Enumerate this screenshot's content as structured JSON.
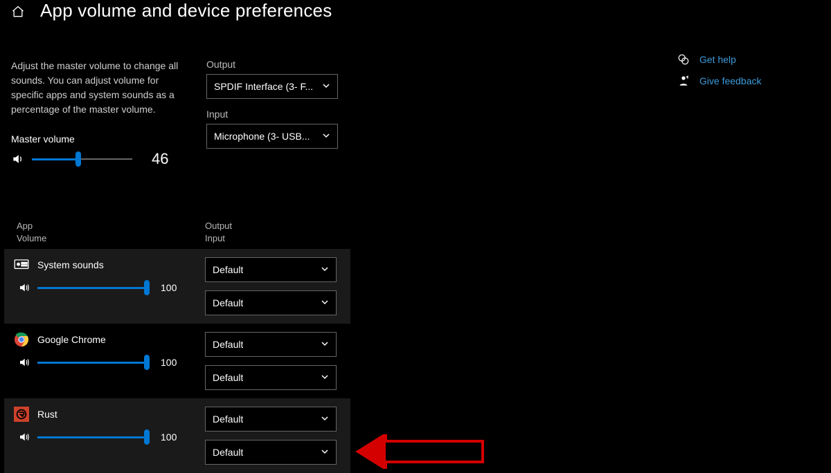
{
  "page": {
    "title": "App volume and device preferences",
    "description": "Adjust the master volume to change all sounds. You can adjust volume for specific apps and system sounds as a percentage of the master volume."
  },
  "master": {
    "label": "Master volume",
    "value": "46",
    "percent": 46
  },
  "output": {
    "label": "Output",
    "selected": "SPDIF Interface (3- F..."
  },
  "input": {
    "label": "Input",
    "selected": "Microphone (3- USB..."
  },
  "columns": {
    "app_line1": "App",
    "app_line2": "Volume",
    "dev_line1": "Output",
    "dev_line2": "Input"
  },
  "apps": [
    {
      "name": "System sounds",
      "volume": "100",
      "percent": 100,
      "output": "Default",
      "input": "Default",
      "highlight": true,
      "icon": "system"
    },
    {
      "name": "Google Chrome",
      "volume": "100",
      "percent": 100,
      "output": "Default",
      "input": "Default",
      "highlight": false,
      "icon": "chrome"
    },
    {
      "name": "Rust",
      "volume": "100",
      "percent": 100,
      "output": "Default",
      "input": "Default",
      "highlight": true,
      "icon": "rust"
    }
  ],
  "help": {
    "get_help": "Get help",
    "feedback": "Give feedback"
  }
}
